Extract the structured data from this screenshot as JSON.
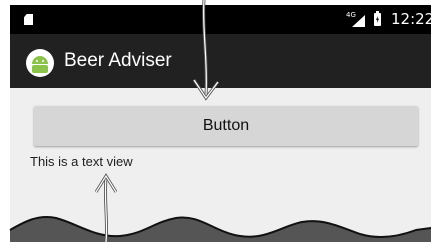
{
  "status_bar": {
    "network_label": "4G",
    "time": "12:22"
  },
  "action_bar": {
    "app_title": "Beer Adviser",
    "logo_icon": "android-robot-icon",
    "logo_color": "#8bc34a"
  },
  "content": {
    "button_label": "Button",
    "text_view": "This is a text view"
  },
  "colors": {
    "status_bar": "#000000",
    "action_bar": "#212121",
    "content_background": "#efefef",
    "button": "#d6d6d6"
  }
}
